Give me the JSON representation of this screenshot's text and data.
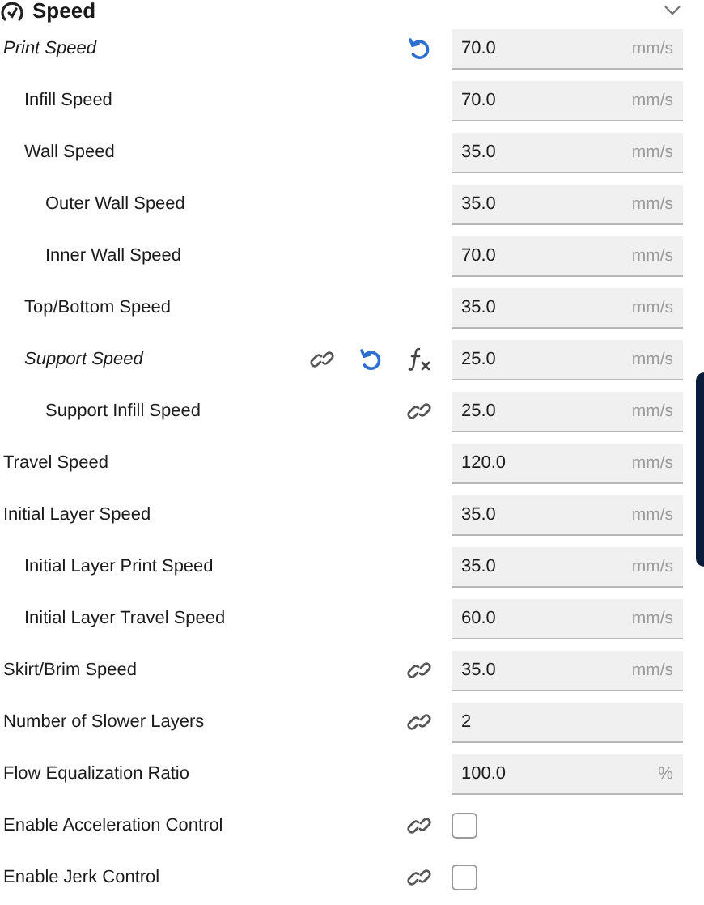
{
  "section": {
    "title": "Speed",
    "expanded": true
  },
  "settings": [
    {
      "label": "Print Speed",
      "modified": true,
      "reset": true,
      "kind": "number",
      "value": "70.0",
      "unit": "mm/s",
      "children": [
        {
          "label": "Infill Speed",
          "modified": false,
          "kind": "number",
          "value": "70.0",
          "unit": "mm/s"
        },
        {
          "label": "Wall Speed",
          "modified": false,
          "kind": "number",
          "value": "35.0",
          "unit": "mm/s",
          "children": [
            {
              "label": "Outer Wall Speed",
              "modified": false,
              "kind": "number",
              "value": "35.0",
              "unit": "mm/s"
            },
            {
              "label": "Inner Wall Speed",
              "modified": false,
              "kind": "number",
              "value": "70.0",
              "unit": "mm/s"
            }
          ]
        },
        {
          "label": "Top/Bottom Speed",
          "modified": false,
          "kind": "number",
          "value": "35.0",
          "unit": "mm/s"
        },
        {
          "label": "Support Speed",
          "modified": true,
          "linked": true,
          "reset": true,
          "formula": true,
          "kind": "number",
          "value": "25.0",
          "unit": "mm/s",
          "children": [
            {
              "label": "Support Infill Speed",
              "modified": false,
              "linked": true,
              "kind": "number",
              "value": "25.0",
              "unit": "mm/s"
            }
          ]
        }
      ]
    },
    {
      "label": "Travel Speed",
      "modified": false,
      "kind": "number",
      "value": "120.0",
      "unit": "mm/s"
    },
    {
      "label": "Initial Layer Speed",
      "modified": false,
      "kind": "number",
      "value": "35.0",
      "unit": "mm/s",
      "children": [
        {
          "label": "Initial Layer Print Speed",
          "modified": false,
          "kind": "number",
          "value": "35.0",
          "unit": "mm/s"
        },
        {
          "label": "Initial Layer Travel Speed",
          "modified": false,
          "kind": "number",
          "value": "60.0",
          "unit": "mm/s"
        }
      ]
    },
    {
      "label": "Skirt/Brim Speed",
      "modified": false,
      "linked": true,
      "kind": "number",
      "value": "35.0",
      "unit": "mm/s"
    },
    {
      "label": "Number of Slower Layers",
      "modified": false,
      "linked": true,
      "kind": "number",
      "value": "2"
    },
    {
      "label": "Flow Equalization Ratio",
      "modified": false,
      "kind": "number",
      "value": "100.0",
      "unit": "%"
    },
    {
      "label": "Enable Acceleration Control",
      "modified": false,
      "linked": true,
      "kind": "checkbox",
      "checked": false
    },
    {
      "label": "Enable Jerk Control",
      "modified": false,
      "linked": true,
      "kind": "checkbox",
      "checked": false
    }
  ]
}
